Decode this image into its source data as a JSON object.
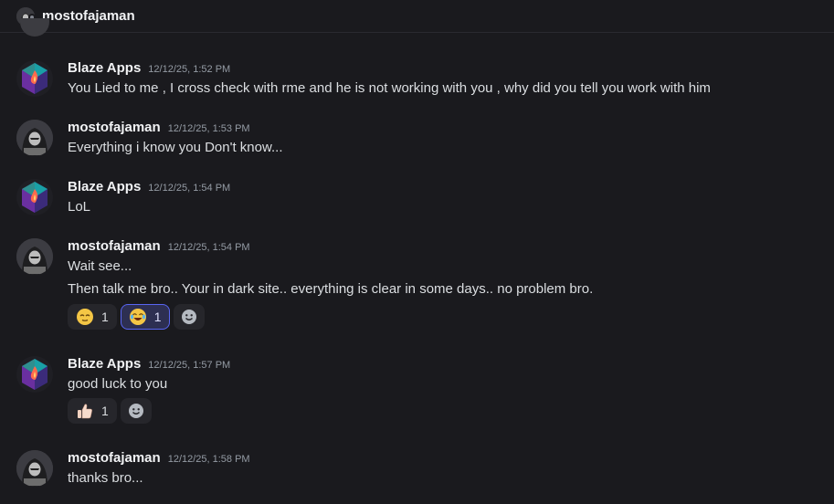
{
  "channel": {
    "name": "mostofajaman"
  },
  "messages": [
    {
      "author": "Blaze Apps",
      "timestamp": "12/12/25, 1:52 PM",
      "lines": [
        "You Lied to me , I cross check with rme and he is not working with you , why did you tell you work with him"
      ]
    },
    {
      "author": "mostofajaman",
      "timestamp": "12/12/25, 1:53 PM",
      "lines": [
        "Everything i know you Don't know..."
      ]
    },
    {
      "author": "Blaze Apps",
      "timestamp": "12/12/25, 1:54 PM",
      "lines": [
        "LoL"
      ]
    },
    {
      "author": "mostofajaman",
      "timestamp": "12/12/25, 1:54 PM",
      "lines": [
        "Wait see...",
        "Then talk me bro.. Your in dark site..  everything is clear in some days.. no problem bro."
      ],
      "reactions": [
        {
          "emoji": "relieved-face",
          "count": "1"
        },
        {
          "emoji": "joy-face",
          "count": "1"
        }
      ]
    },
    {
      "author": "Blaze Apps",
      "timestamp": "12/12/25, 1:57 PM",
      "lines": [
        "good luck to you"
      ],
      "reactions": [
        {
          "emoji": "thumbs-up",
          "count": "1"
        }
      ]
    },
    {
      "author": "mostofajaman",
      "timestamp": "12/12/25, 1:58 PM",
      "lines": [
        "thanks bro..."
      ]
    }
  ],
  "colors": {
    "background": "#1a1a1e",
    "accent": "#5865f2",
    "text": "#dbdee1",
    "muted": "#949ba4"
  }
}
